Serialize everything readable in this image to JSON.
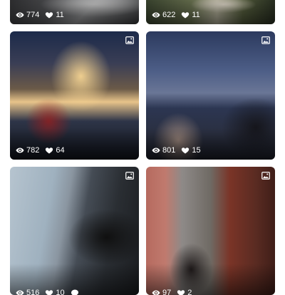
{
  "feed": {
    "cards": [
      {
        "views": "774",
        "likes": "11",
        "media_type": "photo"
      },
      {
        "views": "622",
        "likes": "11",
        "media_type": "photo"
      },
      {
        "views": "782",
        "likes": "64",
        "media_type": "photo"
      },
      {
        "views": "801",
        "likes": "15",
        "media_type": "photo"
      },
      {
        "views": "516",
        "likes": "10",
        "media_type": "photo"
      },
      {
        "views": "97",
        "likes": "2",
        "media_type": "photo"
      }
    ]
  },
  "icons": {
    "views": "eye-icon",
    "likes": "heart-icon",
    "comments": "comment-icon",
    "media_type": "image-icon"
  },
  "colors": {
    "background": "#ffffff",
    "overlay_text": "#ffffff"
  }
}
